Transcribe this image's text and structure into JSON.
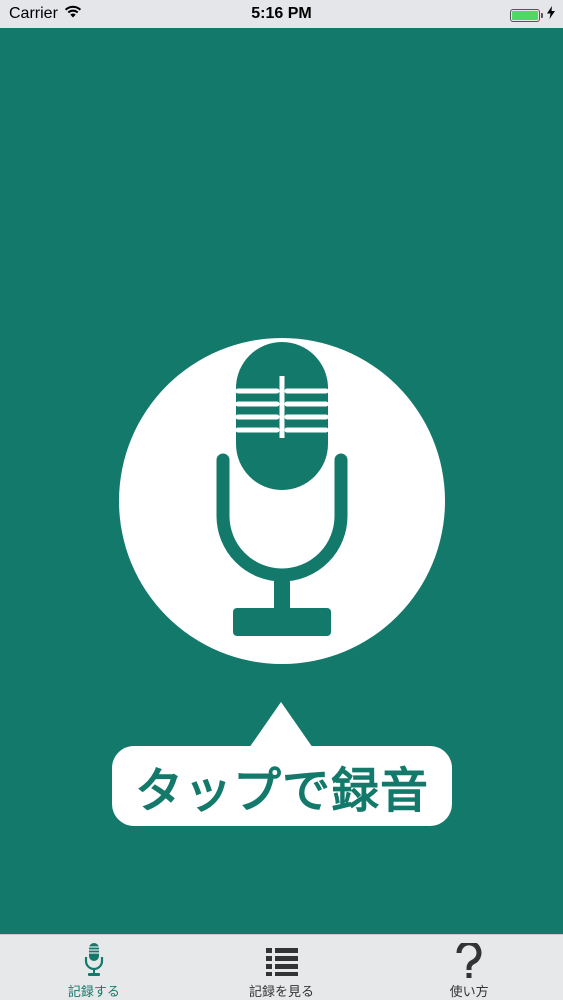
{
  "status_bar": {
    "carrier": "Carrier",
    "time": "5:16 PM",
    "battery_color": "#4CD964"
  },
  "main": {
    "background_color": "#13796A",
    "record_button_icon": "microphone-icon",
    "callout_text": "タップで録音"
  },
  "tab_bar": {
    "active_color": "#13796A",
    "tabs": [
      {
        "label": "記録する",
        "icon": "microphone-icon",
        "active": true
      },
      {
        "label": "記録を見る",
        "icon": "list-icon",
        "active": false
      },
      {
        "label": "使い方",
        "icon": "question-icon",
        "active": false
      }
    ]
  }
}
